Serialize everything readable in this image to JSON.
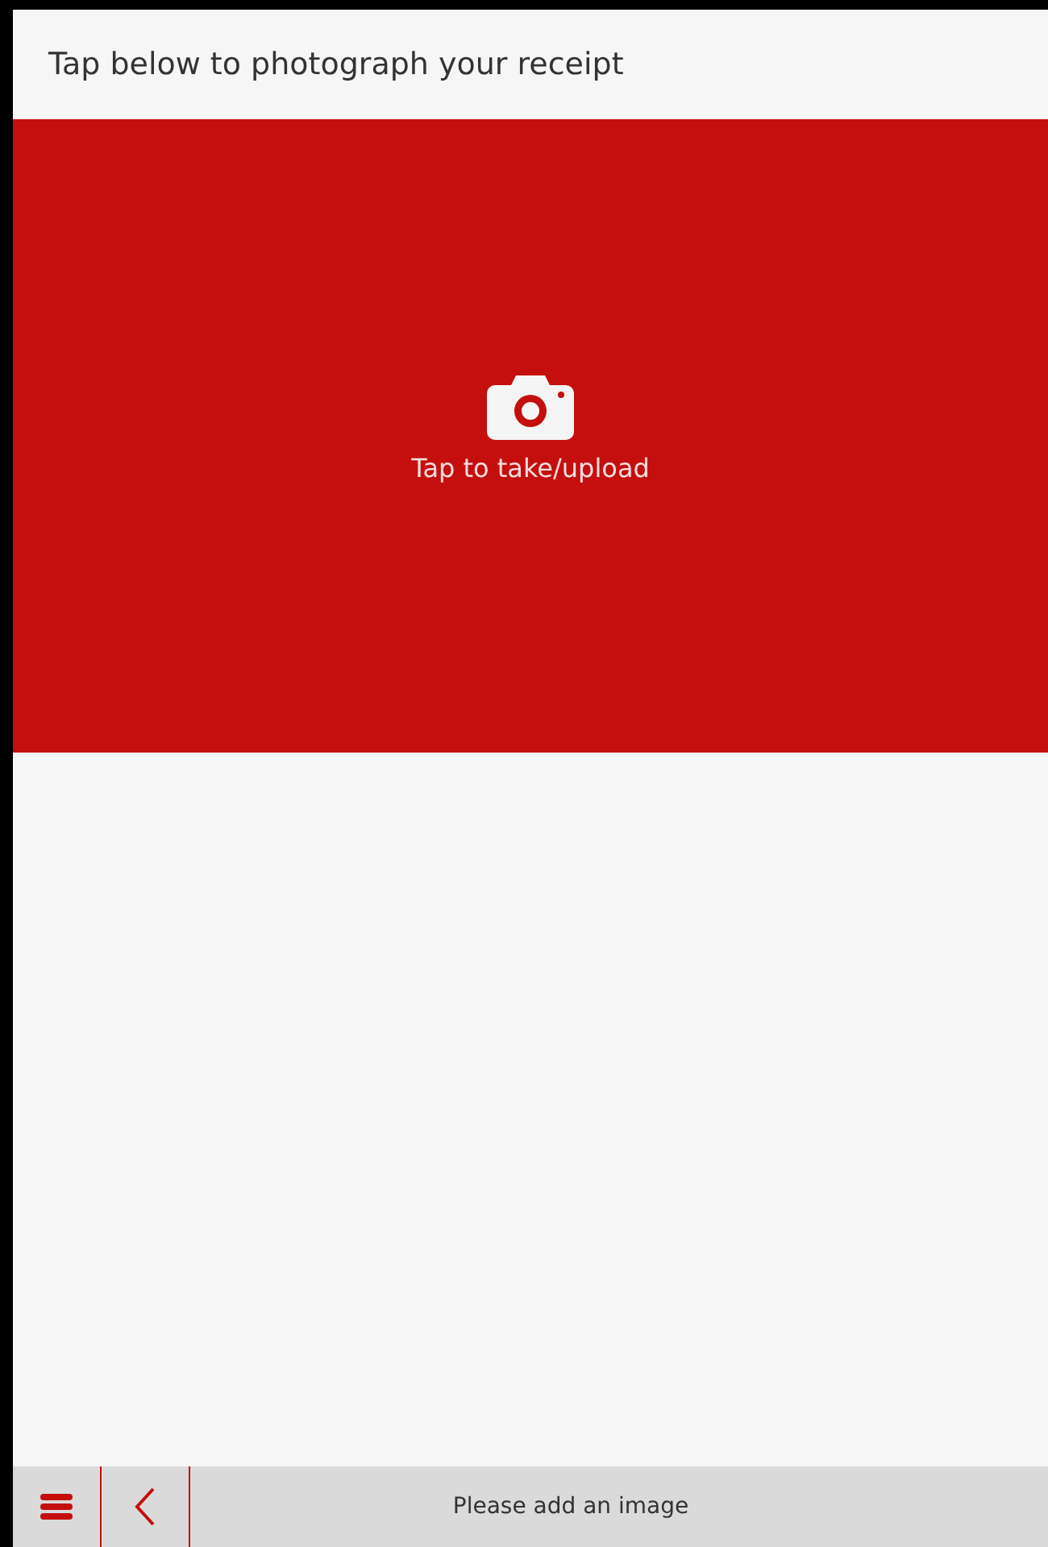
{
  "header": {
    "title": "Tap below to photograph your receipt"
  },
  "upload": {
    "label": "Tap to take/upload"
  },
  "footer": {
    "status": "Please add an image"
  }
}
